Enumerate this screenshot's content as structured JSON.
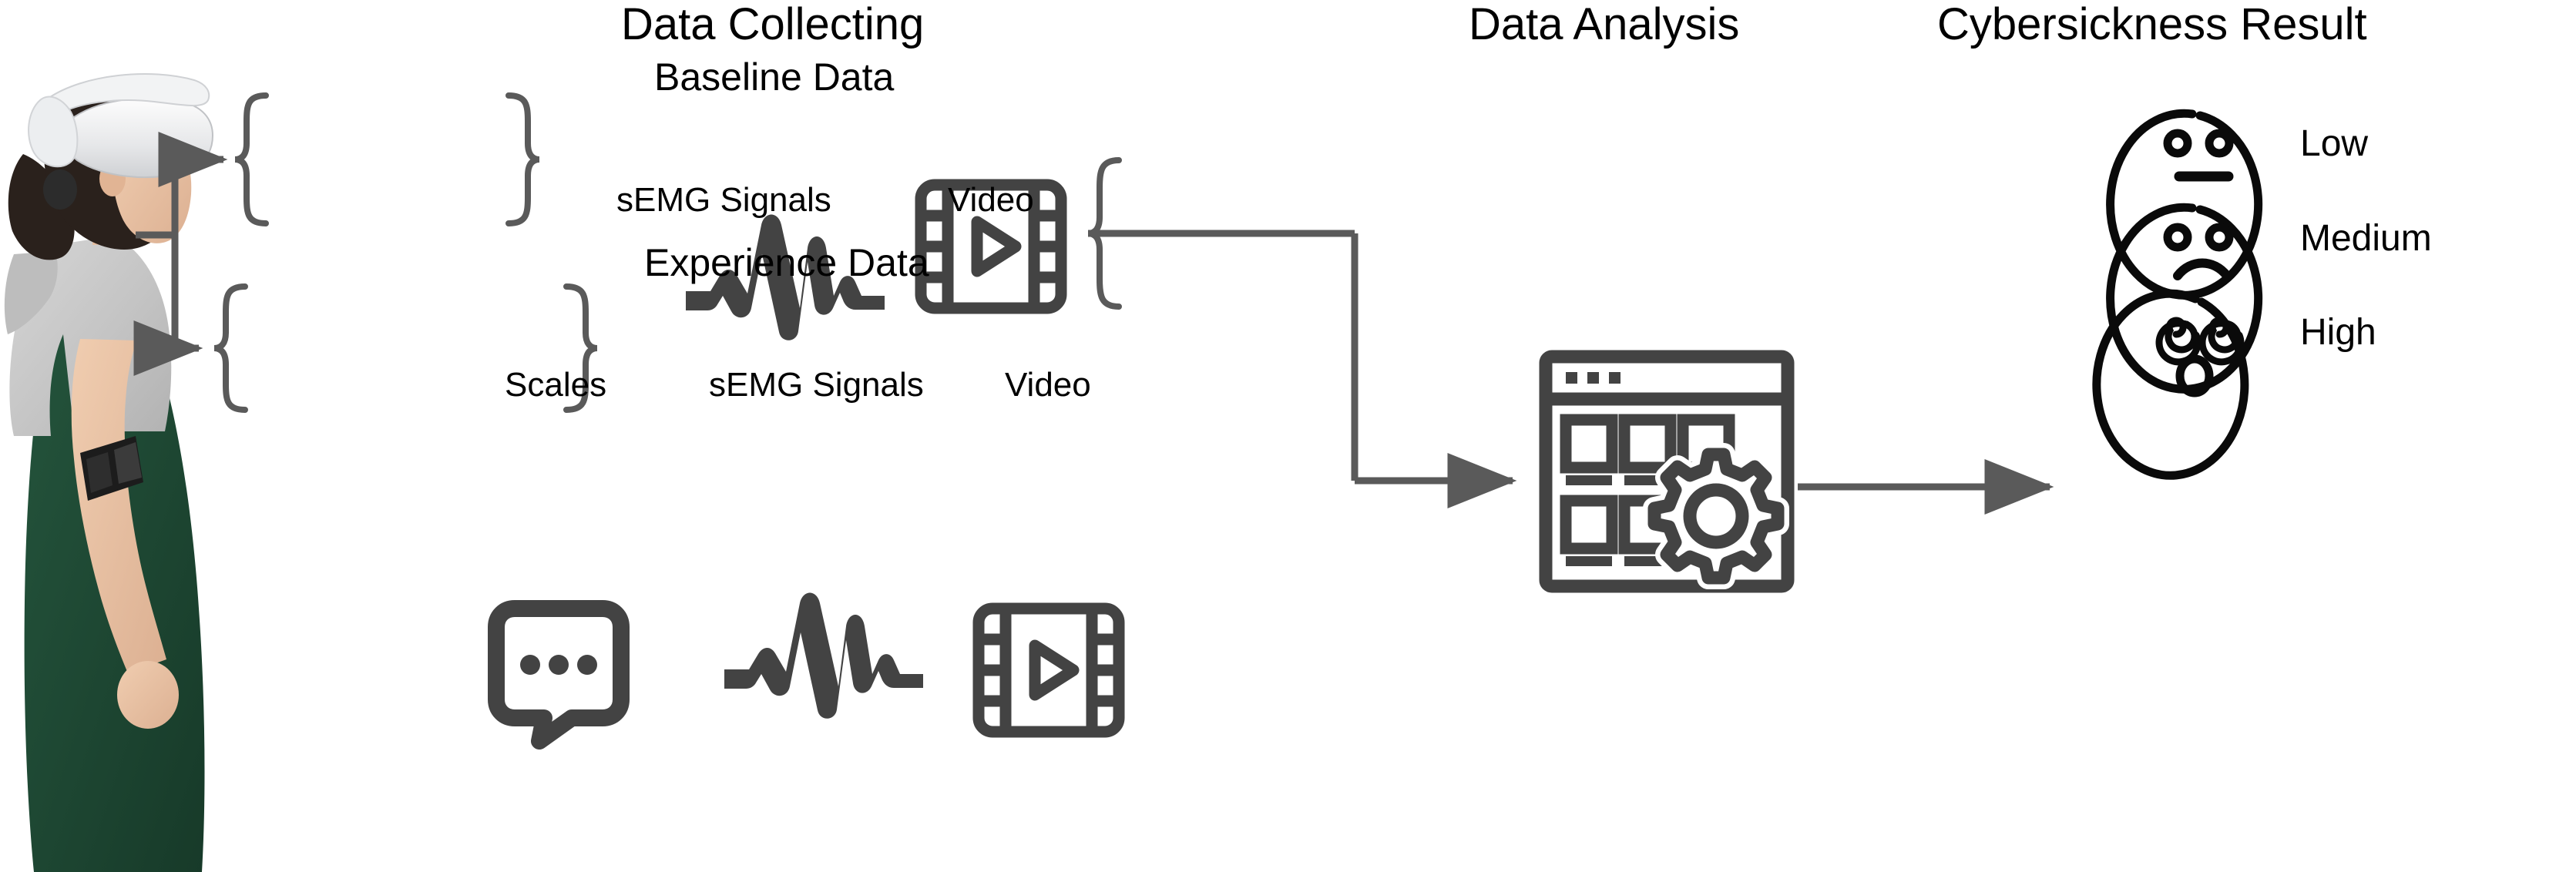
{
  "diagram": {
    "title_stages": [
      {
        "id": "data-collecting",
        "label": "Data Collecting"
      },
      {
        "id": "data-analysis",
        "label": "Data Analysis"
      },
      {
        "id": "cybersickness-result",
        "label": "Cybersickness Result"
      }
    ],
    "colors": {
      "text": "#000000",
      "icon_gray": "#434343",
      "connector_gray": "#5a5a5a",
      "face_black": "#0a0a0a",
      "background": "#ffffff"
    }
  },
  "participant": {
    "name": "vr-participant-photo",
    "description": "Person wearing VR headset with sEMG armband",
    "headset_color": "#e9eaec",
    "hoodie_color": "#c8c8c8",
    "skirt_color": "#1f4f38",
    "armband_color": "#1a1a1a",
    "hair_color": "#2a211c",
    "skin_color": "#e8c3a4"
  },
  "collecting": {
    "groups": [
      {
        "id": "baseline-data",
        "title": "Baseline Data",
        "items": [
          {
            "icon": "waveform-icon",
            "label": "sEMG Signals"
          },
          {
            "icon": "filmstrip-icon",
            "label": "Video"
          }
        ]
      },
      {
        "id": "experience-data",
        "title": "Experience Data",
        "items": [
          {
            "icon": "chat-bubble-icon",
            "label": "Scales"
          },
          {
            "icon": "waveform-icon",
            "label": "sEMG Signals"
          },
          {
            "icon": "filmstrip-icon",
            "label": "Video"
          }
        ]
      }
    ]
  },
  "analysis": {
    "icon": "dashboard-gear-icon",
    "title": "Data Analysis"
  },
  "results": {
    "title": "Cybersickness Result",
    "levels": [
      {
        "id": "low",
        "label": "Low",
        "face": "neutral-face-icon"
      },
      {
        "id": "medium",
        "label": "Medium",
        "face": "sad-face-icon"
      },
      {
        "id": "high",
        "label": "High",
        "face": "dizzy-face-icon"
      }
    ]
  }
}
